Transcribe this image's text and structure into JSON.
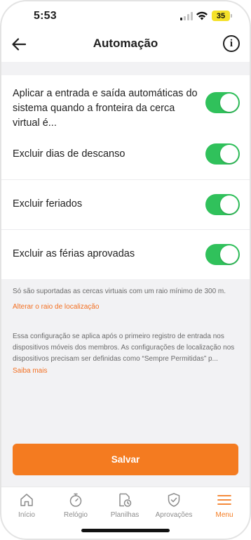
{
  "status_bar": {
    "time": "5:53",
    "battery": "35"
  },
  "header": {
    "title": "Automação"
  },
  "settings": [
    {
      "label": "Aplicar a entrada e saída automáticas do sistema quando a fronteira da cerca virtual é...",
      "enabled": true
    },
    {
      "label": "Excluir dias de descanso",
      "enabled": true
    },
    {
      "label": "Excluir feriados",
      "enabled": true
    },
    {
      "label": "Excluir as férias aprovadas",
      "enabled": true
    }
  ],
  "notes": {
    "radius_text": "Só são suportadas as cercas virtuais com um raio mínimo de 300 m.",
    "radius_link": "Alterar o raio de localização",
    "config_text": "Essa configuração se aplica após o primeiro registro de entrada nos dispositivos móveis dos membros. As configurações de localização nos dispositivos precisam ser definidas como “Sempre Permitidas” p...",
    "learn_more": "Saiba mais"
  },
  "save_label": "Salvar",
  "tabs": [
    {
      "label": "Início",
      "icon": "home-icon"
    },
    {
      "label": "Relógio",
      "icon": "stopwatch-icon"
    },
    {
      "label": "Planilhas",
      "icon": "timesheet-icon"
    },
    {
      "label": "Aprovações",
      "icon": "shield-check-icon"
    },
    {
      "label": "Menu",
      "icon": "menu-icon",
      "active": true
    }
  ],
  "colors": {
    "accent": "#f47b20",
    "toggle_on": "#30c15b",
    "link": "#f36f21"
  }
}
